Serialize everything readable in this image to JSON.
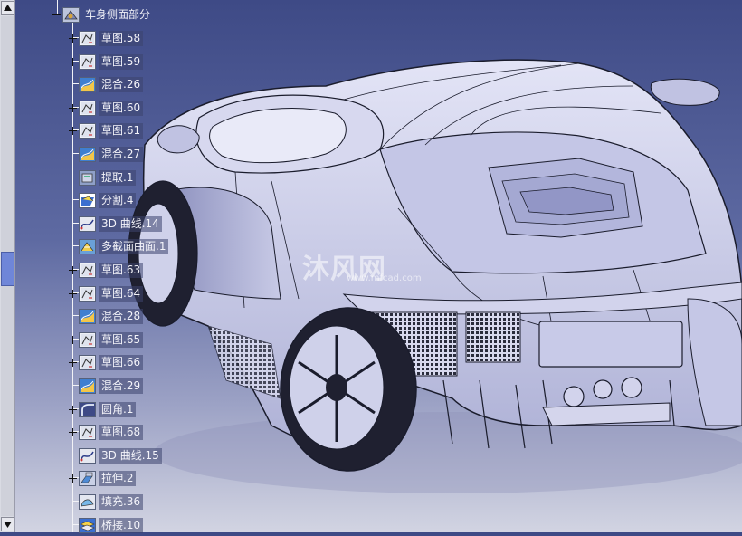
{
  "tree": {
    "root": {
      "label": "车身侧面部分",
      "icon": "part-body-icon"
    },
    "nodes": [
      {
        "label": "草图.58",
        "icon": "sketch-icon",
        "expandable": true
      },
      {
        "label": "草图.59",
        "icon": "sketch-icon",
        "expandable": true
      },
      {
        "label": "混合.26",
        "icon": "blend-surface-icon",
        "expandable": false
      },
      {
        "label": "草图.60",
        "icon": "sketch-icon",
        "expandable": true
      },
      {
        "label": "草图.61",
        "icon": "sketch-icon",
        "expandable": true
      },
      {
        "label": "混合.27",
        "icon": "blend-surface-icon",
        "expandable": false
      },
      {
        "label": "提取.1",
        "icon": "extract-icon",
        "expandable": false
      },
      {
        "label": "分割.4",
        "icon": "split-icon",
        "expandable": false
      },
      {
        "label": "3D 曲线.14",
        "icon": "3d-curve-icon",
        "expandable": false
      },
      {
        "label": "多截面曲面.1",
        "icon": "multi-section-surface-icon",
        "expandable": false
      },
      {
        "label": "草图.63",
        "icon": "sketch-icon",
        "expandable": true
      },
      {
        "label": "草图.64",
        "icon": "sketch-icon",
        "expandable": true
      },
      {
        "label": "混合.28",
        "icon": "blend-surface-icon",
        "expandable": false
      },
      {
        "label": "草图.65",
        "icon": "sketch-icon",
        "expandable": true
      },
      {
        "label": "草图.66",
        "icon": "sketch-icon",
        "expandable": true
      },
      {
        "label": "混合.29",
        "icon": "blend-surface-icon",
        "expandable": false
      },
      {
        "label": "圆角.1",
        "icon": "fillet-icon",
        "expandable": true
      },
      {
        "label": "草图.68",
        "icon": "sketch-icon",
        "expandable": true
      },
      {
        "label": "3D 曲线.15",
        "icon": "3d-curve-icon",
        "expandable": false
      },
      {
        "label": "拉伸.2",
        "icon": "extrude-icon",
        "expandable": true
      },
      {
        "label": "填充.36",
        "icon": "fill-surface-icon",
        "expandable": false
      },
      {
        "label": "桥接.10",
        "icon": "bridge-surface-icon",
        "expandable": false
      }
    ]
  },
  "watermark": {
    "text": "沐风网",
    "sub": "www.mfcad.com"
  },
  "colors": {
    "background_top": "#3e4a86",
    "background_bottom": "#d2d4e2",
    "model_fill": "#c9cbe8",
    "model_edge": "#1a1c2c",
    "label_text": "#f4f4fa"
  }
}
